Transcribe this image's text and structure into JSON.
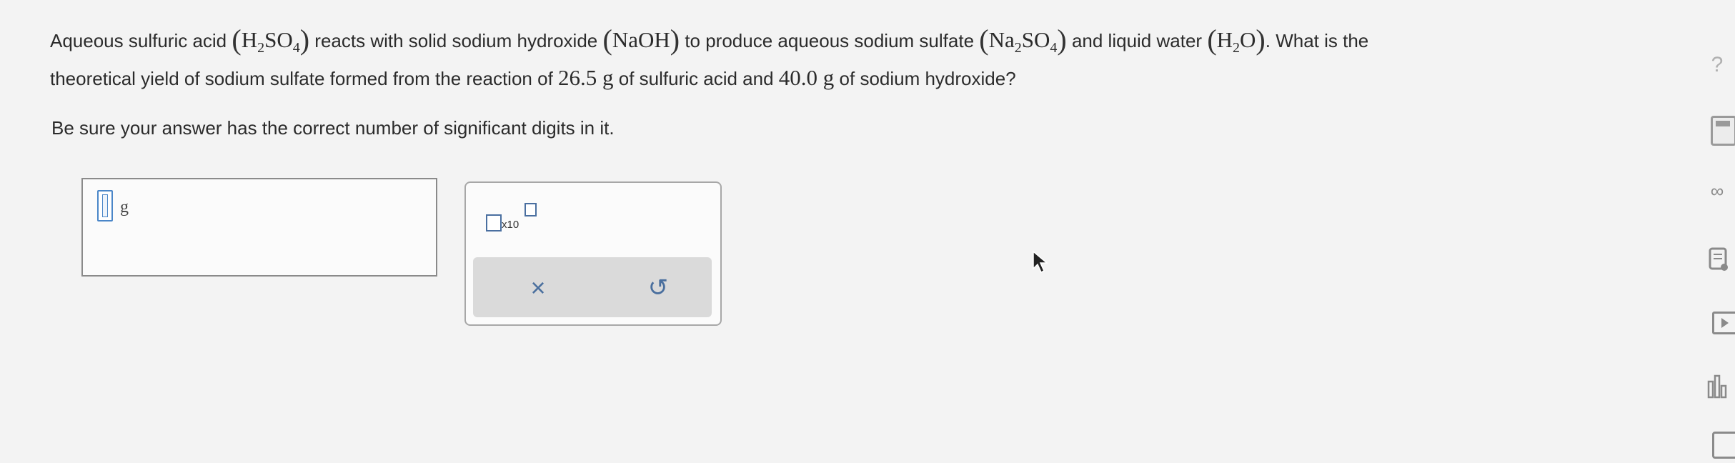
{
  "question": {
    "line1": {
      "t1": "Aqueous sulfuric acid",
      "f1_a": "H",
      "f1_s1": "2",
      "f1_b": "SO",
      "f1_s2": "4",
      "t2": "reacts with solid sodium hydroxide",
      "f2": "NaOH",
      "t3": "to produce aqueous sodium sulfate",
      "f3_a": "Na",
      "f3_s1": "2",
      "f3_b": "SO",
      "f3_s2": "4",
      "t4": "and liquid water",
      "f4_a": "H",
      "f4_s1": "2",
      "f4_b": "O",
      "t5": ". What is the"
    },
    "line2": {
      "t1": "theoretical yield of sodium sulfate formed from the reaction of",
      "n1": "26.5 g",
      "t2": "of sulfuric acid and",
      "n2": "40.0 g",
      "t3": "of sodium hydroxide?"
    },
    "instruction": "Be sure your answer has the correct number of significant digits in it."
  },
  "answer": {
    "unit": "g",
    "value": ""
  },
  "tools": {
    "sci_notation_label": "x10",
    "clear_icon": "×",
    "undo_icon": "↺"
  },
  "sidebar": {
    "help_icon": "?",
    "periodic_icon": "∞"
  }
}
